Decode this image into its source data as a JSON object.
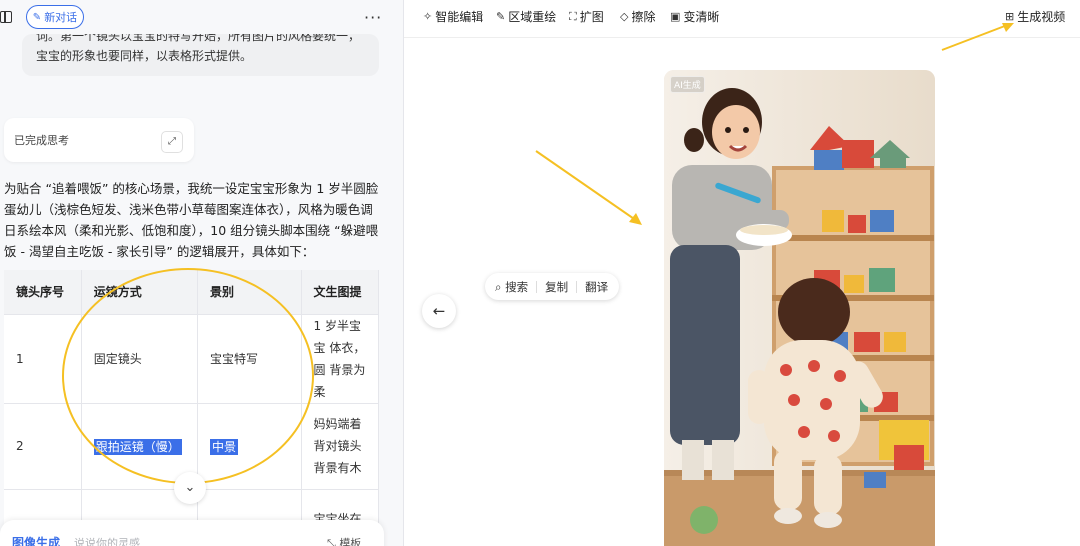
{
  "chat": {
    "new_chat_label": "新对话",
    "more_label": "···",
    "user_message": "词。第一个镜头以宝宝的特写开始，所有图片的风格要统一，宝宝的形象也要同样，以表格形式提供。",
    "thinking_label": "已完成思考",
    "answer_text": "为贴合 “追着喂饭” 的核心场景，我统一设定宝宝形象为 1 岁半圆脸蛋幼儿（浅棕色短发、浅米色带小草莓图案连体衣），风格为暖色调日系绘本风（柔和光影、低饱和度），10 组分镜头脚本围绕 “躲避喂饭 - 渴望自主吃饭 - 家长引导” 的逻辑展开，具体如下：",
    "table": {
      "headers": [
        "镜头序号",
        "运镜方式",
        "景别",
        "文生图提"
      ],
      "rows": [
        {
          "no": "1",
          "move": "固定镜头",
          "shot": "宝宝特写",
          "desc": "1 岁半宝宝 体衣，圆 背景为柔"
        },
        {
          "no": "2",
          "move": "跟拍运镜（慢）",
          "shot": "中景",
          "desc": "妈妈端着 背对镜头 背景有木"
        },
        {
          "no": "",
          "move": "",
          "shot": "",
          "desc": "宝宝坐在"
        }
      ]
    },
    "input": {
      "mode_label": "图像生成",
      "placeholder": "说说你的灵感",
      "template_label": "模板"
    }
  },
  "toolbar": {
    "smart_edit": "智能编辑",
    "region_redraw": "区域重绘",
    "expand": "扩图",
    "erase": "擦除",
    "sharpen": "变清晰",
    "generate_video": "生成视频"
  },
  "floating_menu": {
    "search": "搜索",
    "copy": "复制",
    "translate": "翻译"
  },
  "image": {
    "ai_badge": "AI生成"
  },
  "colors": {
    "accent": "#3b6fe8",
    "annotation": "#f5c023"
  },
  "icons": {
    "sidebar": "sidebar-toggle-icon",
    "back": "arrow-left-icon",
    "scroll": "chevron-down-icon"
  }
}
